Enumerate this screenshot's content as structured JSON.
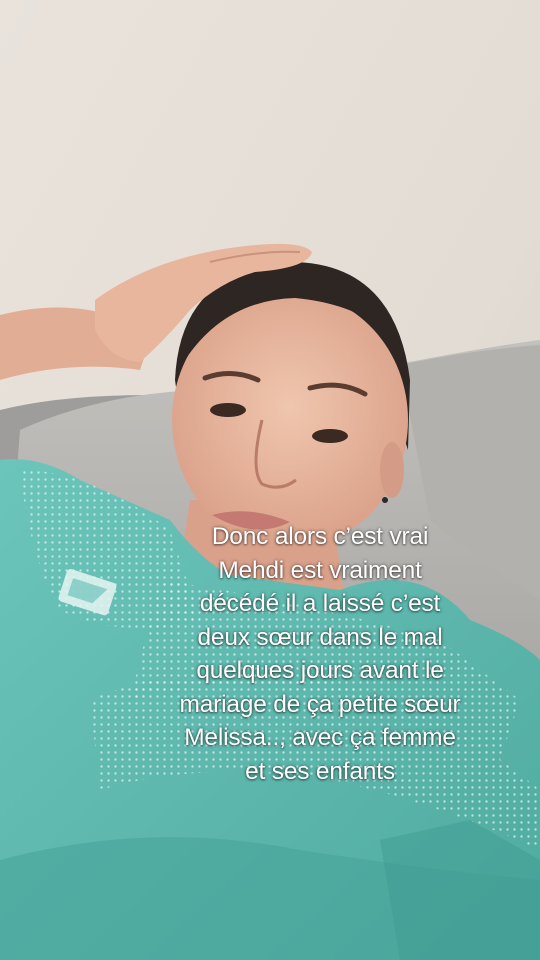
{
  "video": {
    "caption_lines": [
      "Donc alors c’est vrai",
      "Mehdi est vraiment",
      "décédé il a laissé c’est",
      "deux sœur dans le mal",
      "quelques jours avant le",
      "mariage de ça petite sœur",
      "Melissa.., avec ça femme",
      "et ses enfants"
    ]
  },
  "colors": {
    "wall": "#e6e0d9",
    "couch": "#b9b7b5",
    "shirt": "#5fbdb4",
    "skin": "#e9b9a2",
    "hair": "#2b2420",
    "caption_text": "#ffffff"
  }
}
